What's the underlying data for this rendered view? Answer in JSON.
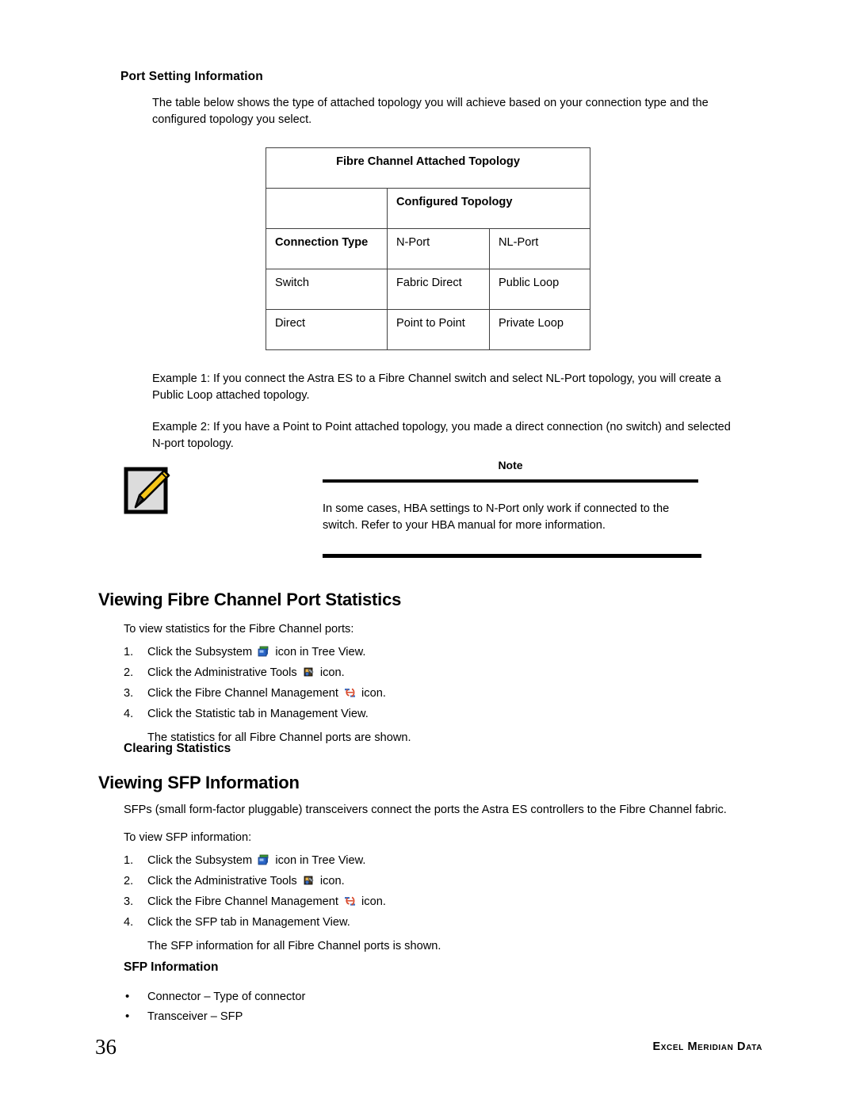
{
  "page": {
    "number": "36",
    "brand": "Excel Meridian Data"
  },
  "port_setting": {
    "heading": "Port Setting Information",
    "intro": "The table below shows the type of attached topology you will achieve based on your connection type and the configured topology you select."
  },
  "topology_table": {
    "title": "Fibre Channel Attached Topology",
    "subheader": "Configured Topology",
    "blank_cell": "",
    "header_row": {
      "connection_type": "Connection Type",
      "col2": "N-Port",
      "col3": "NL-Port"
    },
    "rows": [
      {
        "connection": "Switch",
        "n_port": "Fabric Direct",
        "nl_port": "Public Loop"
      },
      {
        "connection": "Direct",
        "n_port": "Point to Point",
        "nl_port": "Private Loop"
      }
    ]
  },
  "examples": [
    "Example 1: If you connect the Astra ES to a Fibre Channel switch and select NL-Port topology, you will create a Public Loop attached topology.",
    "Example 2: If you have a Point to Point attached topology, you made a direct connection (no switch) and selected N-port topology."
  ],
  "note": {
    "icon": "note-pencil-icon",
    "title": "Note",
    "body": "In some cases, HBA settings to N-Port only work if connected to the switch. Refer to your HBA manual for more information."
  },
  "stats_section": {
    "heading": "Viewing Fibre Channel Port Statistics",
    "lead": "To view statistics for the Fibre Channel ports:",
    "steps": [
      {
        "num": "1.",
        "pre": "Click the Subsystem",
        "icon": "subsystem-icon",
        "post": "icon in Tree View."
      },
      {
        "num": "2.",
        "pre": "Click the Administrative Tools",
        "icon": "administrative-tools-icon",
        "post": "icon."
      },
      {
        "num": "3.",
        "pre": "Click the Fibre Channel Management",
        "icon": "fibre-channel-management-icon",
        "post": "icon."
      },
      {
        "num": "4.",
        "pre": "Click the Statistic tab in Management View.",
        "icon": "",
        "post": ""
      }
    ],
    "result": "The statistics for all Fibre Channel ports are shown.",
    "subheading": "Clearing Statistics"
  },
  "sfp_section": {
    "heading": "Viewing SFP Information",
    "intro": "SFPs (small form-factor pluggable) transceivers connect the ports the Astra ES controllers to the Fibre Channel fabric.",
    "lead": "To view SFP information:",
    "steps": [
      {
        "num": "1.",
        "pre": "Click the Subsystem",
        "icon": "subsystem-icon",
        "post": "icon in Tree View."
      },
      {
        "num": "2.",
        "pre": "Click the Administrative Tools",
        "icon": "administrative-tools-icon",
        "post": "icon."
      },
      {
        "num": "3.",
        "pre": "Click the Fibre Channel Management",
        "icon": "fibre-channel-management-icon",
        "post": "icon."
      },
      {
        "num": "4.",
        "pre": "Click the SFP tab in Management View.",
        "icon": "",
        "post": ""
      }
    ],
    "result": "The SFP information for all Fibre Channel ports is shown.",
    "subheading": "SFP Information",
    "bullets": [
      "Connector – Type of connector",
      "Transceiver – SFP"
    ],
    "bullet_marker": "•"
  },
  "colors": {
    "text": "#000000",
    "table_border": "#404040",
    "note_icon_paper": "#dcdcdc",
    "note_icon_pencil": "#f5c518",
    "subsystem_blue": "#2a66c8",
    "subsystem_green": "#3d9c35",
    "fcm_red": "#d8482a",
    "fcm_blue": "#3b6fc4"
  }
}
